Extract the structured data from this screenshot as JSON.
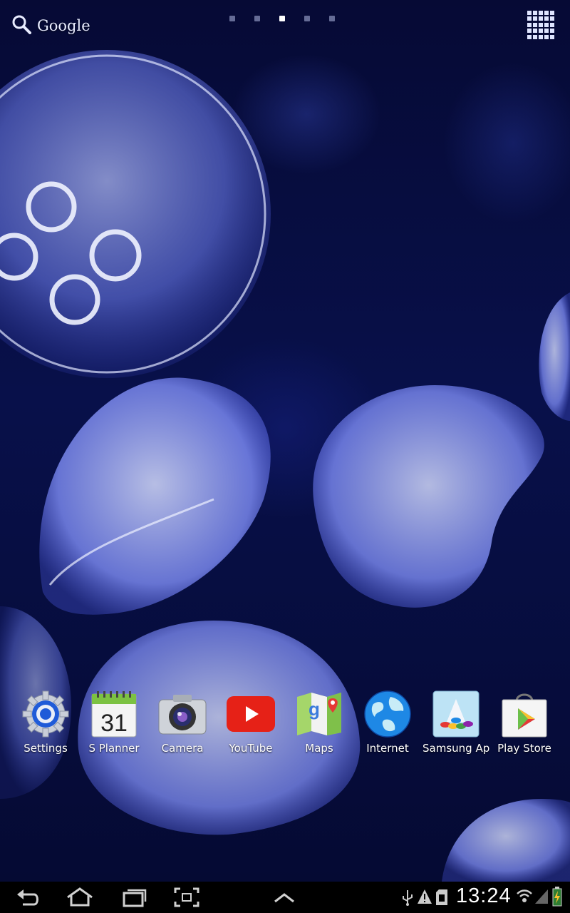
{
  "search": {
    "label": "Google"
  },
  "pager": {
    "count": 5,
    "active": 3
  },
  "dock": {
    "apps": [
      {
        "label": "Settings",
        "icon": "settings-gear-icon"
      },
      {
        "label": "S Planner",
        "icon": "calendar-icon",
        "calendar_day": "31"
      },
      {
        "label": "Camera",
        "icon": "camera-icon"
      },
      {
        "label": "YouTube",
        "icon": "youtube-icon"
      },
      {
        "label": "Maps",
        "icon": "maps-icon"
      },
      {
        "label": "Internet",
        "icon": "globe-icon"
      },
      {
        "label": "Samsung Apps",
        "icon": "samsung-apps-icon"
      },
      {
        "label": "Play Store",
        "icon": "play-store-icon"
      }
    ]
  },
  "system_bar": {
    "time": "13:24",
    "nav": [
      "back-icon",
      "home-icon",
      "recent-apps-icon",
      "screenshot-icon",
      "up-chevron-icon"
    ],
    "status": [
      "usb-icon",
      "warning-icon",
      "sd-card-icon",
      "wifi-icon",
      "signal-icon",
      "battery-icon"
    ]
  },
  "colors": {
    "background": "#05092e",
    "jelly": "#8fa0ff",
    "system_bar": "#000000"
  }
}
